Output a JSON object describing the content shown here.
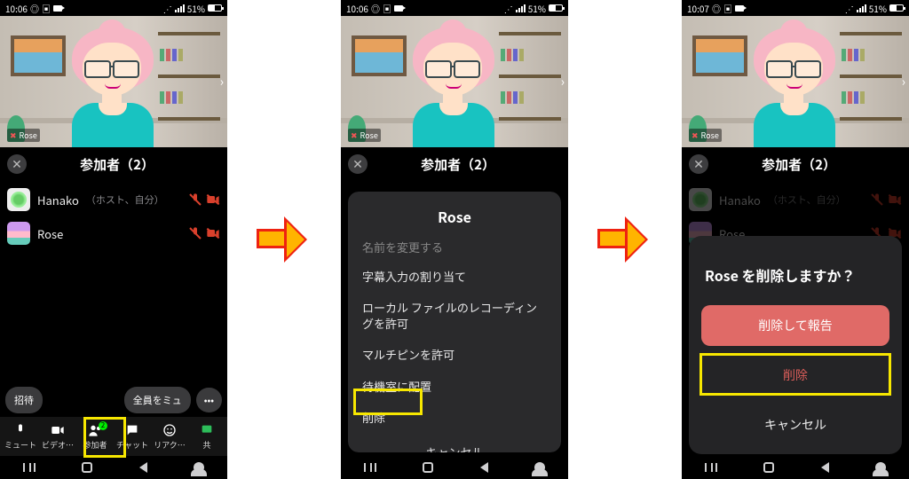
{
  "status": {
    "time1": "10:06",
    "time2": "10:06",
    "time3": "10:07",
    "battery": "51%"
  },
  "video": {
    "participant_name": "Rose"
  },
  "panel": {
    "title": "参加者（2）",
    "participants": [
      {
        "name": "Hanako",
        "sub": "（ホスト、自分）"
      },
      {
        "name": "Rose",
        "sub": ""
      }
    ]
  },
  "actions": {
    "invite": "招待",
    "mute_all": "全員をミュ",
    "more": "•••"
  },
  "toolbar": {
    "mute": "ミュート",
    "video": "ビデオ…",
    "participants": "参加者",
    "participants_badge": "2",
    "chat": "チャット",
    "reactions": "リアク…",
    "share": "共"
  },
  "menu": {
    "title": "Rose",
    "truncated": "名前を変更する",
    "assign_caption": "字幕入力の割り当て",
    "allow_local_record": "ローカル ファイルのレコーディングを許可",
    "allow_multipin": "マルチピンを許可",
    "waiting_room": "待機室に配置",
    "remove": "削除",
    "cancel": "キャンセル"
  },
  "confirm": {
    "title_name": "Rose",
    "title_rest": " を削除しますか？",
    "remove_report": "削除して報告",
    "remove": "削除",
    "cancel": "キャンセル"
  }
}
